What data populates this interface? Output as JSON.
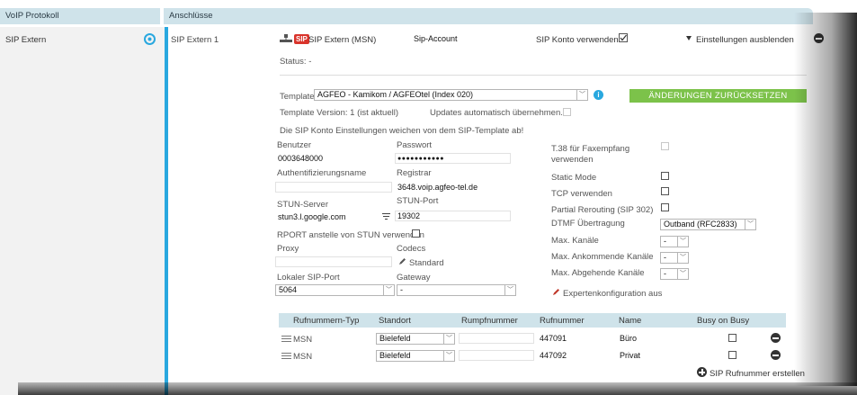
{
  "headers": {
    "left": "VoIP Protokoll",
    "right": "Anschlüsse"
  },
  "left_item": "SIP Extern",
  "account": {
    "name": "SIP Extern 1",
    "badge": "SIP",
    "type_label": "SIP Extern (MSN)",
    "account_name": "Sip-Account",
    "use_label": "SIP Konto verwenden",
    "toggle_label": "Einstellungen ausblenden",
    "status": "Status: -"
  },
  "template": {
    "label": "Template",
    "value": "AGFEO - Kamikom / AGFEOtel (Index 020)",
    "reset_button": "ÄNDERUNGEN ZURÜCKSETZEN",
    "version": "Template Version: 1 (ist aktuell)",
    "auto_update": "Updates automatisch übernehmen.",
    "notice": "Die SIP Konto Einstellungen weichen von dem SIP-Template ab!"
  },
  "form": {
    "benutzer_label": "Benutzer",
    "benutzer": "0003648000",
    "passwort_label": "Passwort",
    "passwort": "●●●●●●●●●●●",
    "auth_label": "Authentifizierungsname",
    "registrar_label": "Registrar",
    "registrar": "3648.voip.agfeo-tel.de",
    "stun_label": "STUN-Server",
    "stun": "stun3.l.google.com",
    "stun_port_label": "STUN-Port",
    "stun_port": "19302",
    "rport_label": "RPORT anstelle von STUN verwenden",
    "proxy_label": "Proxy",
    "codecs_label": "Codecs",
    "codecs_value": "Standard",
    "sip_port_label": "Lokaler SIP-Port",
    "sip_port": "5064",
    "gateway_label": "Gateway",
    "gateway": "-"
  },
  "right_form": {
    "t38_line1": "T.38 für Faxempfang",
    "t38_line2": "verwenden",
    "static_mode": "Static Mode",
    "tcp": "TCP verwenden",
    "partial_rerouting": "Partial Rerouting (SIP 302)",
    "dtmf_label": "DTMF Übertragung",
    "dtmf": "Outband (RFC2833)",
    "max_kanaele": "Max. Kanäle",
    "max_kanaele_value": "-",
    "max_ankommende": "Max. Ankommende Kanäle",
    "max_ankommende_value": "-",
    "max_abgehende": "Max. Abgehende Kanäle",
    "max_abgehende_value": "-",
    "expert": "Expertenkonfiguration aus"
  },
  "table": {
    "headers": [
      "Rufnummern-Typ",
      "Standort",
      "Rumpfnummer",
      "Rufnummer",
      "Name",
      "Busy on Busy"
    ],
    "rows": [
      {
        "type": "MSN",
        "standort": "Bielefeld",
        "rumpf": "",
        "rufnummer": "447091",
        "name": "Büro"
      },
      {
        "type": "MSN",
        "standort": "Bielefeld",
        "rumpf": "",
        "rufnummer": "447092",
        "name": "Privat"
      }
    ],
    "add_label": "SIP Rufnummer erstellen"
  },
  "colors": {
    "accent": "#29a8df",
    "header_bg": "#cfe3ea",
    "button_green": "#7cc24a"
  }
}
